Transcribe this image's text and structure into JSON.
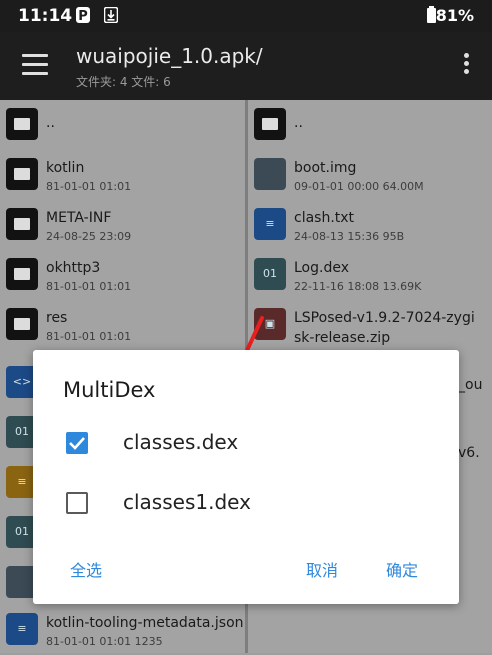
{
  "status_bar": {
    "time": "11:14",
    "battery": "81%"
  },
  "toolbar": {
    "title": "wuaipojie_1.0.apk/",
    "subtitle": "文件夹: 4  文件: 6"
  },
  "left_pane": [
    {
      "name": "..",
      "meta": "",
      "icon": "folder-icon"
    },
    {
      "name": "kotlin",
      "meta": "81-01-01 01:01",
      "icon": "folder-icon"
    },
    {
      "name": "META-INF",
      "meta": "24-08-25 23:09",
      "icon": "folder-icon"
    },
    {
      "name": "okhttp3",
      "meta": "81-01-01 01:01",
      "icon": "folder-icon"
    },
    {
      "name": "res",
      "meta": "81-01-01 01:01",
      "icon": "folder-icon"
    }
  ],
  "left_bottom": {
    "name": "kotlin-tooling-metadata.json",
    "meta": "81-01-01 01:01 1235"
  },
  "right_pane": [
    {
      "name": "..",
      "meta": "",
      "icon": "folder-icon"
    },
    {
      "name": "boot.img",
      "meta": "09-01-01 00:00  64.00M",
      "icon": "image-file-icon"
    },
    {
      "name": "clash.txt",
      "meta": "24-08-13 15:36  95B",
      "icon": "text-file-icon"
    },
    {
      "name": "Log.dex",
      "meta": "22-11-16 18:08  13.69K",
      "icon": "dex-file-icon"
    },
    {
      "name": "LSPosed-v1.9.2-7024-zygi",
      "name2": "sk-release.zip",
      "icon": "zip-file-icon"
    }
  ],
  "right_partial": {
    "text1": "_ou",
    "text2": "v6."
  },
  "dialog": {
    "title": "MultiDex",
    "options": [
      {
        "label": "classes.dex",
        "checked": true
      },
      {
        "label": "classes1.dex",
        "checked": false
      }
    ],
    "select_all": "全选",
    "cancel": "取消",
    "confirm": "确定"
  },
  "colors": {
    "accent": "#2e88dc",
    "arrow": "#e8201f"
  }
}
